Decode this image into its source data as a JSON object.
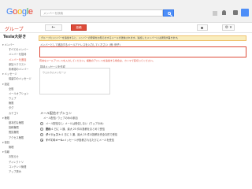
{
  "header": {
    "logo": "Google",
    "search_placeholder": "メンバーを検索"
  },
  "subheader": {
    "brand": "グループ",
    "back_label": "←",
    "post_label": "投稿",
    "gear_label": "⚙ ▾"
  },
  "sidebar": {
    "title": "Tesla大好き",
    "items": [
      {
        "label": "▾ メンバー",
        "type": "sec"
      },
      {
        "label": "すべてのメンバー",
        "type": "item"
      },
      {
        "label": "メンバーを招待",
        "type": "item"
      },
      {
        "label": "メンバーを追加",
        "type": "item",
        "active": true
      },
      {
        "label": "参加リクエスト",
        "type": "item"
      },
      {
        "label": "未承認のメンバー",
        "type": "item"
      },
      {
        "label": "▾ メッセージ",
        "type": "sec"
      },
      {
        "label": "保留中のメッセージ",
        "type": "item"
      },
      {
        "label": "▾ 設定",
        "type": "sec"
      },
      {
        "label": "全般",
        "type": "item"
      },
      {
        "label": "メールオプション",
        "type": "item"
      },
      {
        "label": "ウェブ",
        "type": "item"
      },
      {
        "label": "権限",
        "type": "item"
      },
      {
        "label": "タグ",
        "type": "item"
      },
      {
        "label": "カテゴリ",
        "type": "item"
      },
      {
        "label": "▾ 権限",
        "type": "sec"
      },
      {
        "label": "基本的な権限",
        "type": "item"
      },
      {
        "label": "投稿権限",
        "type": "item"
      },
      {
        "label": "閲覧権限",
        "type": "item"
      },
      {
        "label": "アクセス権限",
        "type": "item"
      },
      {
        "label": "▾ 役割",
        "type": "sec"
      },
      {
        "label": "管理",
        "type": "item"
      },
      {
        "label": "▾ 情報",
        "type": "sec"
      },
      {
        "label": "お知らせ",
        "type": "item"
      },
      {
        "label": "ディレクトリ",
        "type": "item"
      },
      {
        "label": "コンテンツ管理",
        "type": "item"
      },
      {
        "label": "アップ済み",
        "type": "item"
      }
    ]
  },
  "content": {
    "notice": "グループにメンバーを追加すると、メンバーの登録をお知らせするメールが送信されます。追加したメンバーには通知が届きます。",
    "addr_label": "メンバーとして追加するメールアドレスを入力してください（例: 例子）",
    "addr_value": "",
    "addr_error": "有効なメールアドレスを入力してください。複数のアドレスを追加する場合は、カンマで区切ってください。",
    "message_label": "招待メッセージを作成",
    "message_placeholder": "ウェルカムメッセージ",
    "options_title": "メール配信オプション",
    "options_subtitle": "メール配信: ウェブのみの参加",
    "options": [
      {
        "bold": "",
        "text": "メール配信なし: メールは受信しない（ウェブのみ）",
        "checked": false
      },
      {
        "bold": "要約:",
        "text": "1 日に 1 通、最大 25 件の投稿をまとめて受信",
        "checked": false
      },
      {
        "bold": "ダイジェスト:",
        "text": "1 日に 1 通、最大 25 件の投稿を完全な形で受信",
        "checked": false
      },
      {
        "bold": "すべてのメール:",
        "text": "メッセージが投稿されるたびにメールを受信",
        "checked": true
      }
    ]
  },
  "colors": {
    "brand": "#dd4b39",
    "search_button": "#4d8ef8",
    "error": "#dd4b39"
  }
}
